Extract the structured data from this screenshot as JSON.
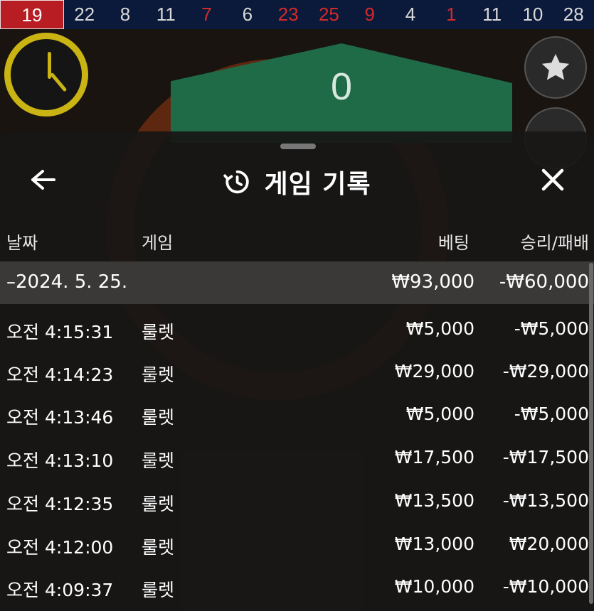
{
  "results_strip": [
    {
      "value": "19",
      "color": "red",
      "current": true
    },
    {
      "value": "22",
      "color": "black"
    },
    {
      "value": "8",
      "color": "black"
    },
    {
      "value": "11",
      "color": "black"
    },
    {
      "value": "7",
      "color": "red"
    },
    {
      "value": "6",
      "color": "black"
    },
    {
      "value": "23",
      "color": "red"
    },
    {
      "value": "25",
      "color": "red"
    },
    {
      "value": "9",
      "color": "red"
    },
    {
      "value": "4",
      "color": "black"
    },
    {
      "value": "1",
      "color": "red"
    },
    {
      "value": "11",
      "color": "black"
    },
    {
      "value": "10",
      "color": "black"
    },
    {
      "value": "28",
      "color": "black"
    }
  ],
  "scene": {
    "zero_label": "0"
  },
  "panel": {
    "title": "게임 기록",
    "columns": {
      "date": "날짜",
      "game": "게임",
      "bet": "베팅",
      "winloss": "승리/패배"
    },
    "date_group": {
      "date": "–2024. 5. 25.",
      "bet": "₩93,000",
      "winloss": "-₩60,000"
    },
    "rows": [
      {
        "time": "오전 4:15:31",
        "game": "룰렛",
        "bet": "₩5,000",
        "winloss": "-₩5,000"
      },
      {
        "time": "오전 4:14:23",
        "game": "룰렛",
        "bet": "₩29,000",
        "winloss": "-₩29,000"
      },
      {
        "time": "오전 4:13:46",
        "game": "룰렛",
        "bet": "₩5,000",
        "winloss": "-₩5,000"
      },
      {
        "time": "오전 4:13:10",
        "game": "룰렛",
        "bet": "₩17,500",
        "winloss": "-₩17,500"
      },
      {
        "time": "오전 4:12:35",
        "game": "룰렛",
        "bet": "₩13,500",
        "winloss": "-₩13,500"
      },
      {
        "time": "오전 4:12:00",
        "game": "룰렛",
        "bet": "₩13,000",
        "winloss": "₩20,000"
      },
      {
        "time": "오전 4:09:37",
        "game": "룰렛",
        "bet": "₩10,000",
        "winloss": "-₩10,000"
      }
    ]
  },
  "colors": {
    "strip_bg": "#0b1a3a",
    "red": "#d42a2a",
    "accent_clock": "#c9b414",
    "table_green": "#1f6b48"
  },
  "icons": {
    "back": "arrow-left-icon",
    "history": "history-icon",
    "close": "close-icon",
    "clock": "clock-icon",
    "star": "star-icon"
  }
}
